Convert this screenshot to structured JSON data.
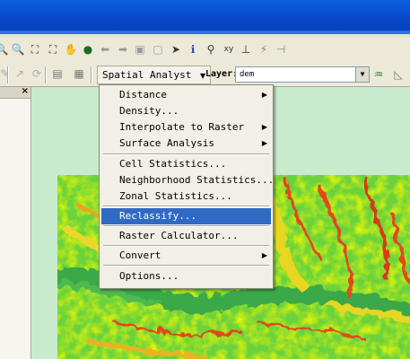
{
  "toolbar": {
    "spatial_analyst_label": "Spatial Analyst",
    "layer_label": "Layer:",
    "layer_value": "dem"
  },
  "menu": {
    "items": [
      {
        "label": "Distance",
        "submenu": true
      },
      {
        "label": "Density...",
        "submenu": false
      },
      {
        "label": "Interpolate to Raster",
        "submenu": true
      },
      {
        "label": "Surface Analysis",
        "submenu": true
      },
      {
        "label": "Cell Statistics...",
        "submenu": false
      },
      {
        "label": "Neighborhood Statistics...",
        "submenu": false
      },
      {
        "label": "Zonal Statistics...",
        "submenu": false
      },
      {
        "label": "Reclassify...",
        "submenu": false,
        "highlighted": true
      },
      {
        "label": "Raster Calculator...",
        "submenu": false
      },
      {
        "label": "Convert",
        "submenu": true
      },
      {
        "label": "Options...",
        "submenu": false
      }
    ]
  },
  "icons": [
    "zoom-in-icon",
    "zoom-out-icon",
    "full-extent-icon",
    "fixed-zoom-icon",
    "pan-icon",
    "globe-icon",
    "back-icon",
    "forward-icon",
    "select-features-icon",
    "clear-selection-icon",
    "select-elements-icon",
    "identify-icon",
    "find-icon",
    "go-to-xy-icon",
    "measure-icon",
    "hyperlink-icon",
    "flash-icon"
  ],
  "colors": {
    "title_bar": "#0847c8",
    "menu_highlight": "#316ac5",
    "map_background": "#c9ebcd"
  }
}
